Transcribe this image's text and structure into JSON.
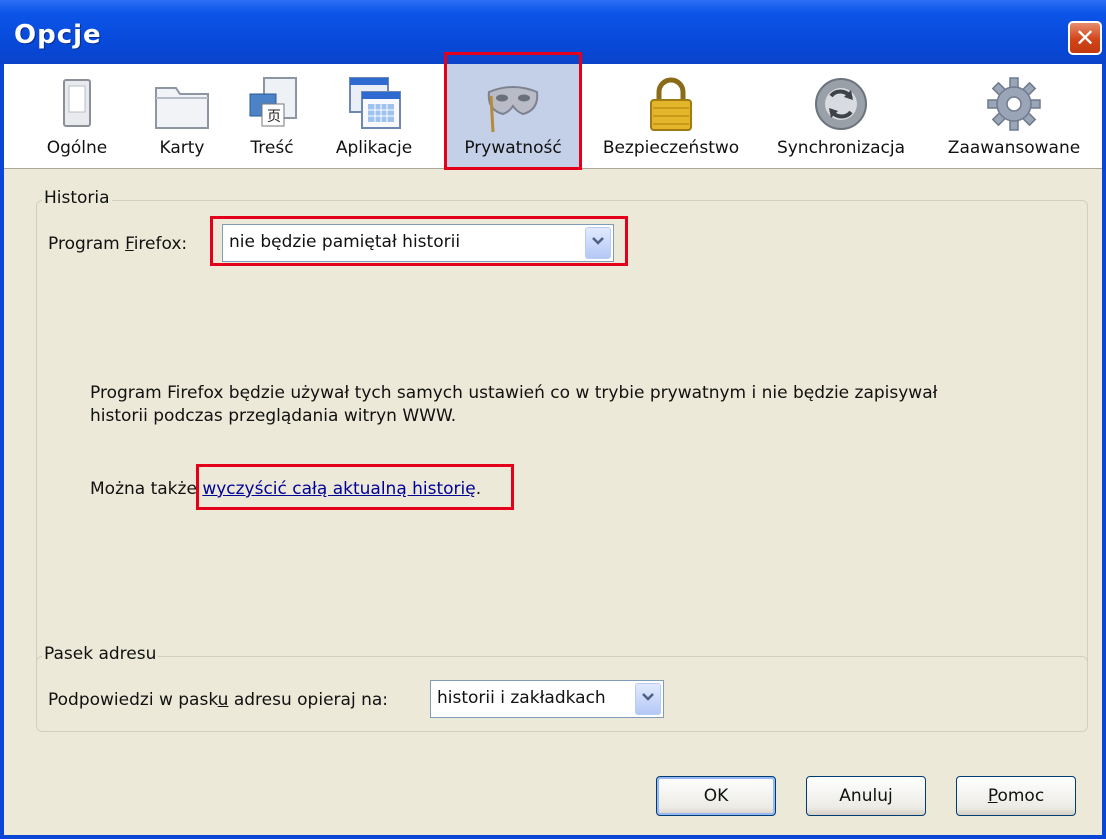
{
  "window": {
    "title": "Opcje",
    "close_glyph": "✕"
  },
  "toolbar": {
    "items": [
      {
        "label": "Ogólne",
        "icon": "general-icon"
      },
      {
        "label": "Karty",
        "icon": "tabs-icon"
      },
      {
        "label": "Treść",
        "icon": "content-icon"
      },
      {
        "label": "Aplikacje",
        "icon": "applications-icon"
      },
      {
        "label": "Prywatność",
        "icon": "privacy-mask-icon",
        "selected": true
      },
      {
        "label": "Bezpieczeństwo",
        "icon": "security-lock-icon"
      },
      {
        "label": "Synchronizacja",
        "icon": "sync-icon"
      },
      {
        "label": "Zaawansowane",
        "icon": "advanced-gear-icon"
      }
    ]
  },
  "history": {
    "group_title": "Historia",
    "label_pre": "Program ",
    "label_accel": "F",
    "label_post": "irefox:",
    "select_value": "nie będzie pamiętał historii",
    "description_line1": "Program Firefox będzie używał tych samych ustawień co w trybie prywatnym i nie będzie zapisywał",
    "description_line2": "historii podczas przeglądania witryn WWW.",
    "clear_prefix": "Można także ",
    "clear_link": "wyczyścić całą aktualną historię",
    "clear_suffix": "."
  },
  "address_bar": {
    "group_title": "Pasek adresu",
    "label_pre": "Podpowiedzi w pask",
    "label_accel": "u",
    "label_post": " adresu opieraj na:",
    "select_value": "historii i zakładkach"
  },
  "buttons": {
    "ok": "OK",
    "cancel": "Anuluj",
    "help_accel": "P",
    "help_rest": "omoc"
  },
  "colors": {
    "highlight": "#e4001a",
    "titlebar": "#0a46d6",
    "dialog_bg": "#ece9d8",
    "link": "#000099"
  }
}
